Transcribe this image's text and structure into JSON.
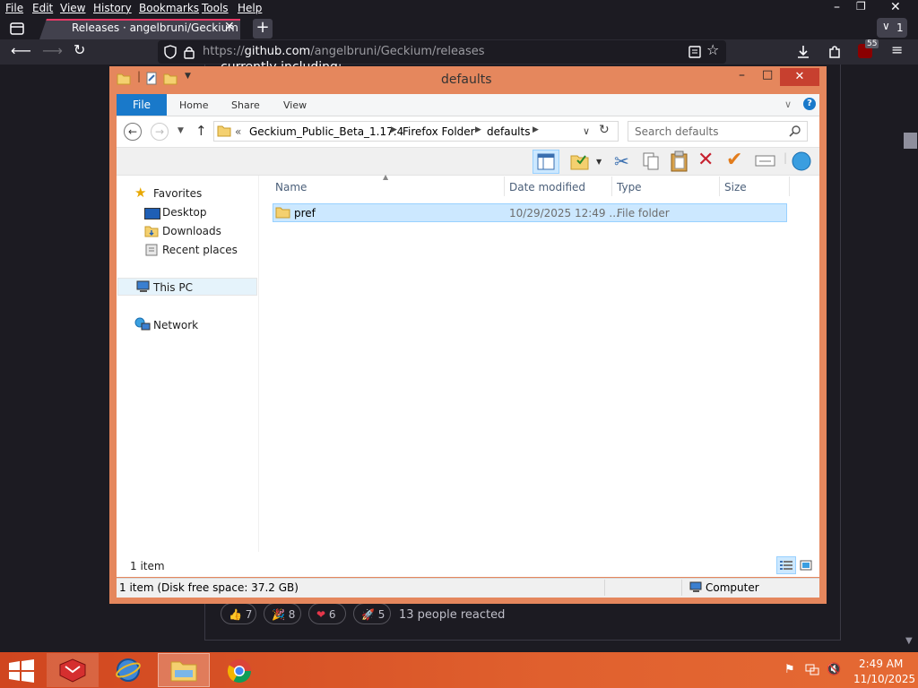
{
  "browser": {
    "menu": [
      "File",
      "Edit",
      "View",
      "History",
      "Bookmarks",
      "Tools",
      "Help"
    ],
    "tab_title": "Releases · angelbruni/Geckium",
    "tabs_overflow_count": "1",
    "url_prefix": "https://",
    "url_host": "github.com",
    "url_path": "/angelbruni/Geckium/releases",
    "extension_badge": "55"
  },
  "page": {
    "snippet": "currently including:",
    "reactions": [
      {
        "emoji": "👍",
        "count": "7"
      },
      {
        "emoji": "🎉",
        "count": "8"
      },
      {
        "emoji": "❤",
        "count": "6"
      },
      {
        "emoji": "🚀",
        "count": "5"
      }
    ],
    "reactions_summary": "13 people reacted"
  },
  "explorer": {
    "title": "defaults",
    "ribbon_tabs": [
      "File",
      "Home",
      "Share",
      "View"
    ],
    "breadcrumb_prefix": "«",
    "breadcrumb": [
      "Geckium_Public_Beta_1.17.4",
      "Firefox Folder",
      "defaults"
    ],
    "search_placeholder": "Search defaults",
    "nav": {
      "favorites": "Favorites",
      "desktop": "Desktop",
      "downloads": "Downloads",
      "recent": "Recent places",
      "this_pc": "This PC",
      "network": "Network"
    },
    "columns": [
      "Name",
      "Date modified",
      "Type",
      "Size"
    ],
    "files": [
      {
        "name": "pref",
        "date": "10/29/2025 12:49 ...",
        "type": "File folder",
        "size": ""
      }
    ],
    "item_count": "1 item",
    "status_left": "1 item (Disk free space: 37.2 GB)",
    "status_right": "Computer"
  },
  "taskbar": {
    "time": "2:49 AM",
    "date": "11/10/2025"
  },
  "colors": {
    "accent": "#e5875d",
    "taskbar": "#d0461f",
    "file_tab": "#1979ca",
    "selection": "#cce8ff"
  }
}
